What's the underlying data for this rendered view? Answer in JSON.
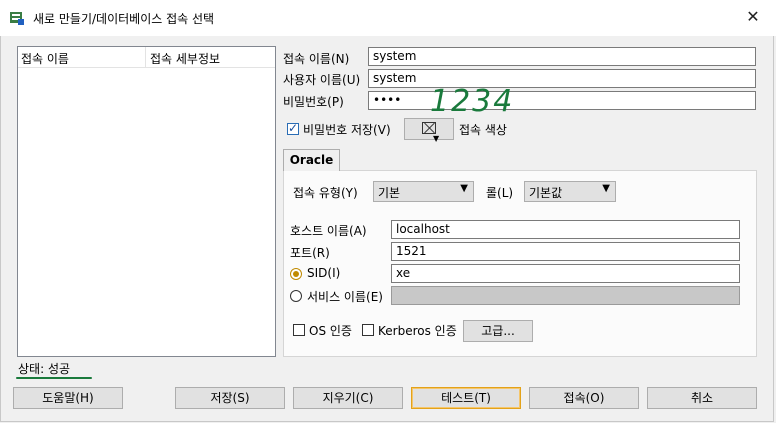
{
  "window": {
    "title": "새로 만들기/데이터베이스 접속 선택",
    "close_glyph": "✕"
  },
  "list": {
    "col_name": "접속 이름",
    "col_details": "접속 세부정보"
  },
  "form": {
    "conn_name_label": "접속 이름(N)",
    "conn_name_value": "system",
    "user_label": "사용자 이름(U)",
    "user_value": "system",
    "password_label": "비밀번호(P)",
    "password_value": "••••",
    "save_password_label": "비밀번호 저장(V)",
    "save_password_checked": true,
    "conn_color_label": "접속 색상"
  },
  "annotation": {
    "handwritten_text": "1234"
  },
  "tab": {
    "label": "Oracle"
  },
  "oracle": {
    "conn_type_label": "접속 유형(Y)",
    "conn_type_value": "기본",
    "role_label": "롤(L)",
    "role_value": "기본값",
    "host_label": "호스트 이름(A)",
    "host_value": "localhost",
    "port_label": "포트(R)",
    "port_value": "1521",
    "sid_label": "SID(I)",
    "sid_value": "xe",
    "sid_selected": true,
    "service_label": "서비스 이름(E)",
    "service_value": "",
    "os_auth_label": "OS 인증",
    "kerberos_label": "Kerberos 인증",
    "advanced_label": "고급..."
  },
  "status": {
    "text": "상태: 성공"
  },
  "buttons": {
    "help": "도움말(H)",
    "save": "저장(S)",
    "clear": "지우기(C)",
    "test": "테스트(T)",
    "connect": "접속(O)",
    "cancel": "취소"
  },
  "colors": {
    "annotation_green": "#1a7a3c",
    "focus_orange": "#e3a21a",
    "radio_gold": "#c08a00"
  }
}
